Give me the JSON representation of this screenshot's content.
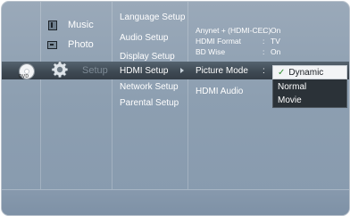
{
  "categories": [
    {
      "label": "Music"
    },
    {
      "label": "Photo"
    },
    {
      "label": "Setup"
    }
  ],
  "disc_tag": "DVD",
  "setup_menu": [
    {
      "label": "Language Setup"
    },
    {
      "label": "Audio Setup"
    },
    {
      "label": "Display Setup"
    },
    {
      "label": "HDMI Setup"
    },
    {
      "label": "Network Setup"
    },
    {
      "label": "Parental Setup"
    }
  ],
  "hdmi_settings": [
    {
      "label": "Anynet + (HDMI-CEC)",
      "value": "On"
    },
    {
      "label": "HDMI Format",
      "value": "TV"
    },
    {
      "label": "BD Wise",
      "value": "On"
    },
    {
      "label": "Picture Mode",
      "value": ""
    },
    {
      "label": "HDMI Audio",
      "value": ""
    }
  ],
  "separator": ":",
  "picture_mode_options": [
    {
      "label": "Dynamic",
      "selected": true
    },
    {
      "label": "Normal",
      "selected": false
    },
    {
      "label": "Movie",
      "selected": false
    }
  ],
  "check_mark": "✓",
  "colors": {
    "background": "#8d9fb1",
    "highlight": "#3f4a54",
    "dropdown_bg": "#2b3238",
    "selected_bg": "#f2f4f6"
  }
}
